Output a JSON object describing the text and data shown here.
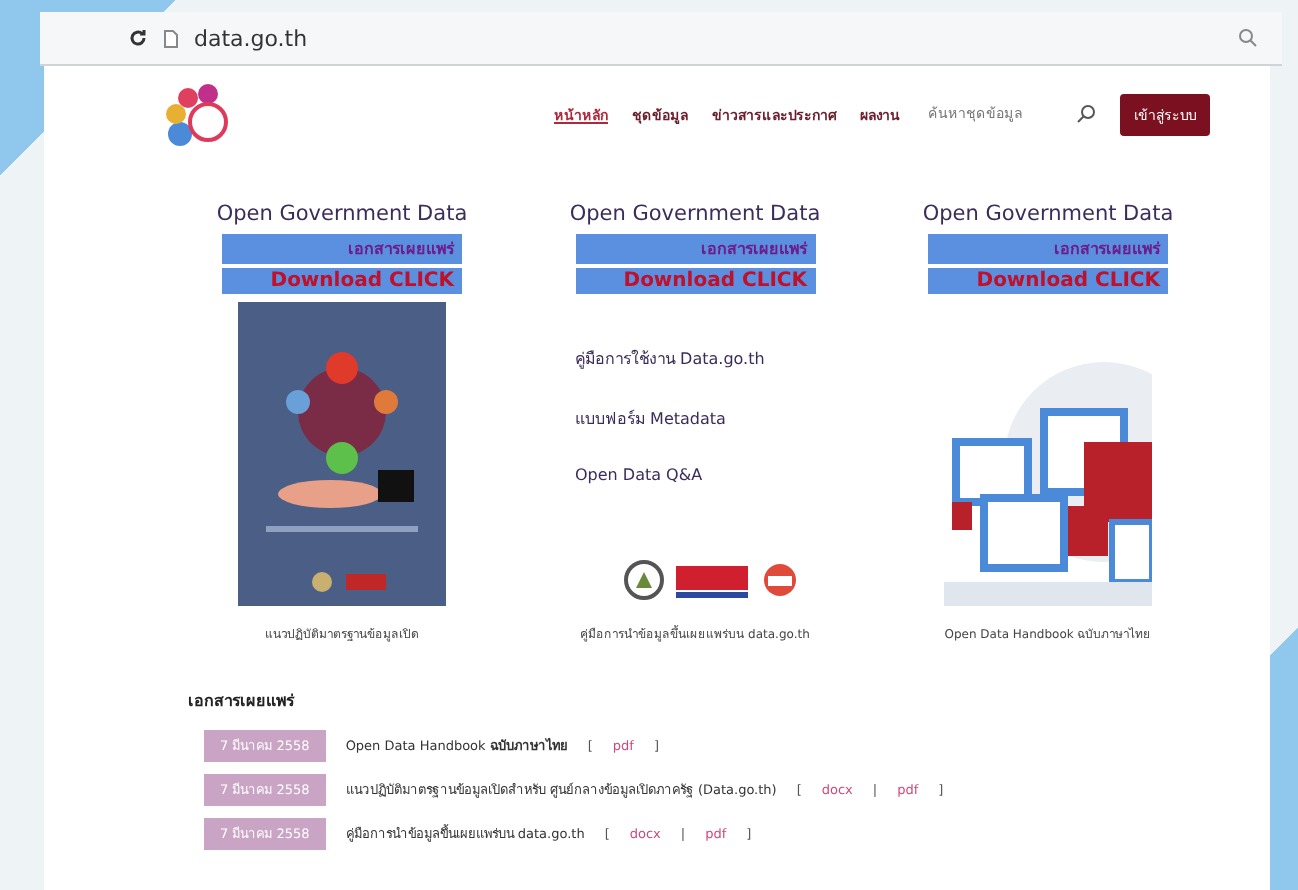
{
  "browser": {
    "url": "data.go.th"
  },
  "header": {
    "nav": [
      {
        "label": "หน้าหลัก",
        "selected": true
      },
      {
        "label": "ชุดข้อมูล",
        "selected": false
      },
      {
        "label": "ข่าวสารและประกาศ",
        "selected": false
      },
      {
        "label": "ผลงาน",
        "selected": false
      }
    ],
    "search": {
      "placeholder": "ค้นหาชุดข้อมูล"
    },
    "login_button": "เข้าสู่ระบบ"
  },
  "downloads": [
    {
      "kind": "picture",
      "heading": "Open Government Data",
      "tag": "เอกสารเผยแพร่",
      "button": "Download CLICK",
      "caption": "แนวปฏิบัติมาตรฐานข้อมูลเปิด"
    },
    {
      "kind": "links",
      "heading": "Open Government Data",
      "tag": "เอกสารเผยแพร่",
      "button": "Download CLICK",
      "links": [
        "คู่มือการใช้งาน Data.go.th",
        "แบบฟอร์ม Metadata",
        "Open Data Q&A"
      ],
      "caption": "คู่มือการนำข้อมูลขึ้นเผยแพร่บน data.go.th"
    },
    {
      "kind": "picture",
      "heading": "Open Government Data",
      "tag": "เอกสารเผยแพร่",
      "button": "Download CLICK",
      "caption": "Open Data Handbook ฉบับภาษาไทย"
    }
  ],
  "publications": {
    "title": "เอกสารเผยแพร่",
    "open": "[",
    "separator": "|",
    "close": "]",
    "items": [
      {
        "date": "7 มีนาคม 2558",
        "title": "Open Data Handbook **ฉบับภาษาไทย**",
        "files": [
          "pdf"
        ]
      },
      {
        "date": "7 มีนาคม 2558",
        "title": "แนวปฏิบัติมาตรฐานข้อมูลเปิดสำหรับ ศูนย์กลางข้อมูลเปิดภาครัฐ (Data.go.th)",
        "files": [
          "docx",
          "pdf"
        ]
      },
      {
        "date": "7 มีนาคม 2558",
        "title": "คู่มือการนำข้อมูลขึ้นเผยแพร่บน data.go.th",
        "files": [
          "docx",
          "pdf"
        ]
      }
    ]
  }
}
